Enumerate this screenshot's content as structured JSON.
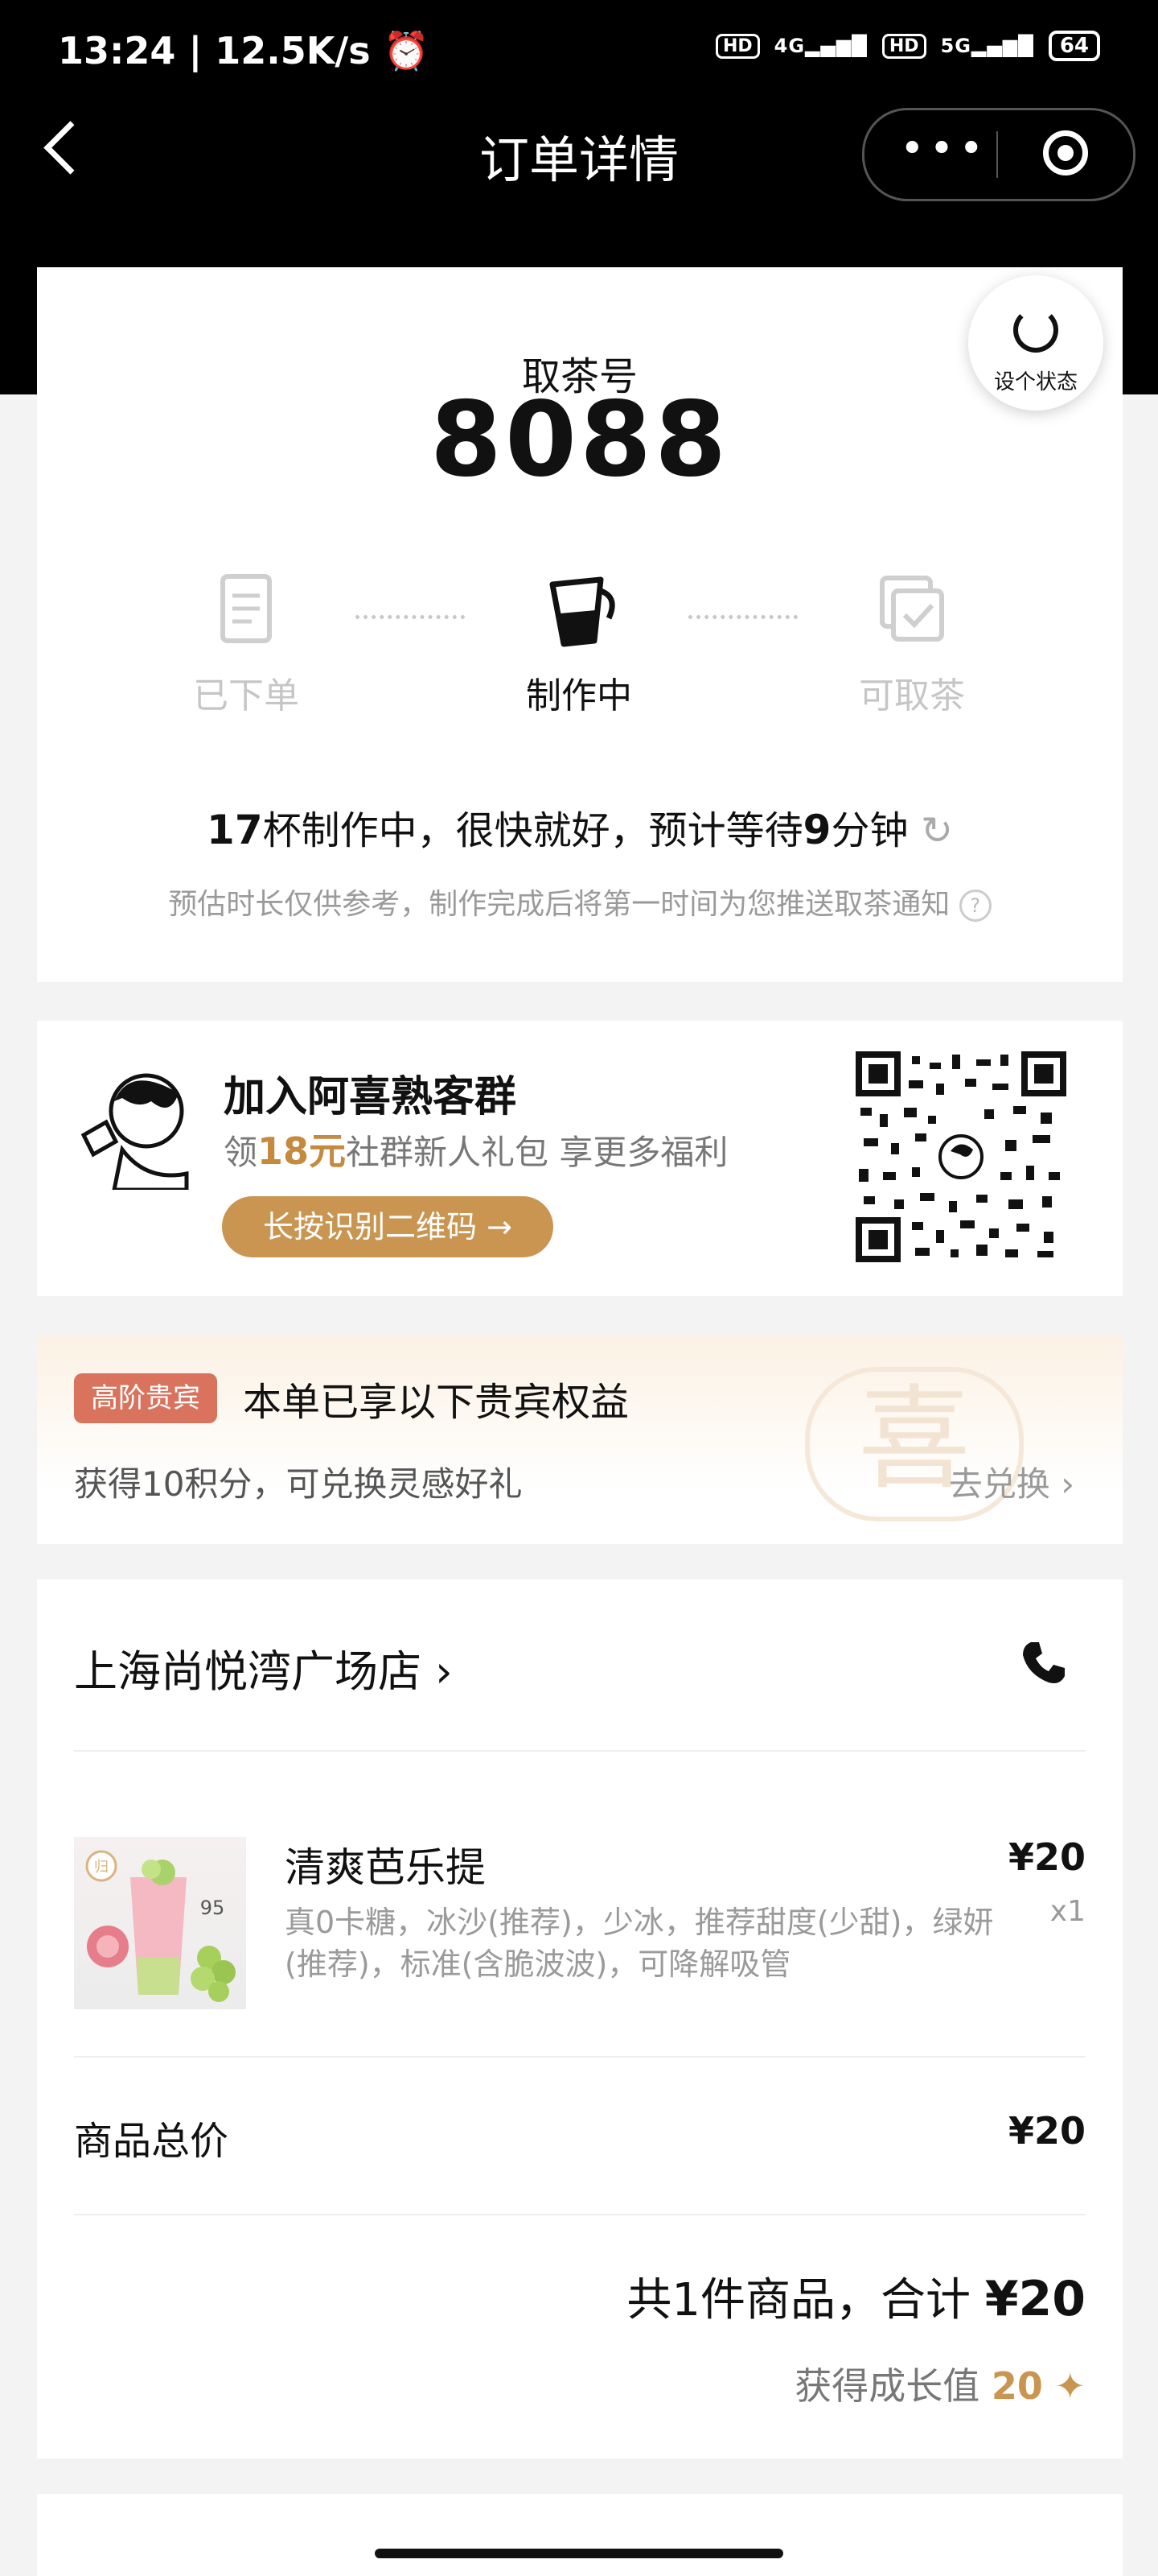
{
  "status_bar": {
    "time_speed": "13:24 | 12.5K/s",
    "alarm_icon": "alarm-icon",
    "hd1": "HD",
    "net1": "4G",
    "hd2": "HD",
    "net2": "5G",
    "battery": "64"
  },
  "nav": {
    "title": "订单详情",
    "more_icon": "more-dots-icon",
    "target_icon": "target-icon"
  },
  "pickup": {
    "title": "取茶号",
    "number": "8088",
    "set_status_label": "设个状态",
    "steps": [
      {
        "label": "已下单",
        "icon": "receipt-icon",
        "active": false
      },
      {
        "label": "制作中",
        "icon": "shaker-cup-icon",
        "active": true
      },
      {
        "label": "可取茶",
        "icon": "check-box-icon",
        "active": false
      }
    ],
    "wait_count": "17",
    "wait_text_a": "杯制作中，很快就好，预计等待",
    "wait_minutes": "9",
    "wait_text_b": "分钟",
    "note": "预估时长仅供参考，制作完成后将第一时间为您推送取茶通知"
  },
  "group": {
    "title": "加入阿喜熟客群",
    "sub_a": "领",
    "amount": "18元",
    "sub_b": "社群新人礼包 享更多福利",
    "button": "长按识别二维码 →"
  },
  "vip": {
    "badge": "高阶贵宾",
    "title": "本单已享以下贵宾权益",
    "points_text": "获得10积分，可兑换灵感好礼",
    "link": "去兑换 ›",
    "watermark": "喜"
  },
  "order": {
    "store": "上海尚悦湾广场店 ›",
    "item": {
      "name": "清爽芭乐提",
      "options": "真0卡糖，冰沙(推荐)，少冰，推荐甜度(少甜)，绿妍(推荐)，标准(含脆波波)，可降解吸管",
      "price": "¥20",
      "qty": "x1",
      "thumb_badge": "归",
      "thumb_num": "95"
    },
    "subtotal_label": "商品总价",
    "subtotal": "¥20",
    "total_prefix": "共1件商品，合计 ",
    "total": "¥20",
    "growth_prefix": "获得成长值 ",
    "growth_value": "20",
    "growth_star": "✦"
  },
  "colors": {
    "accent": "#c99550",
    "vip_badge": "#d9735d",
    "header": "#000000"
  }
}
